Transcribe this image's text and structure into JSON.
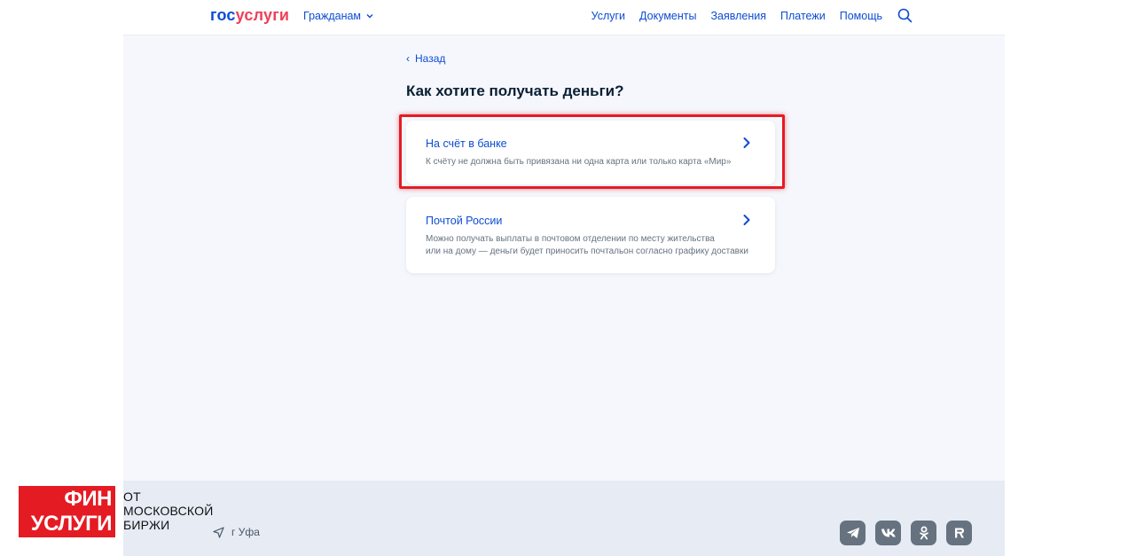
{
  "header": {
    "logo_gos": "гос",
    "logo_uslugi": "услуги",
    "citizens_label": "Гражданам",
    "nav": [
      "Услуги",
      "Документы",
      "Заявления",
      "Платежи",
      "Помощь"
    ]
  },
  "main": {
    "back_label": "Назад",
    "title": "Как хотите получать деньги?",
    "options": [
      {
        "title": "На счёт в банке",
        "description": [
          "К счёту не должна быть привязана ни одна карта или только карта «Мир»"
        ]
      },
      {
        "title": "Почтой России",
        "description": [
          "Можно получать выплаты в почтовом отделении по месту жительства",
          "или на дому — деньги будет приносить почтальон согласно графику доставки"
        ]
      }
    ]
  },
  "footer": {
    "location": "г Уфа",
    "socials": [
      "telegram-icon",
      "vk-icon",
      "odnoklassniki-icon",
      "rutube-icon"
    ]
  },
  "watermark": {
    "line1": "ФИН",
    "line2": "УСЛУГИ",
    "text1": "ОТ",
    "text2": "МОСКОВСКОЙ",
    "text3": "БИРЖИ"
  },
  "colors": {
    "accent": "#0d4cd3",
    "brand_red": "#ee3f58",
    "highlight": "#e51b23",
    "background": "#f5f7fc"
  }
}
